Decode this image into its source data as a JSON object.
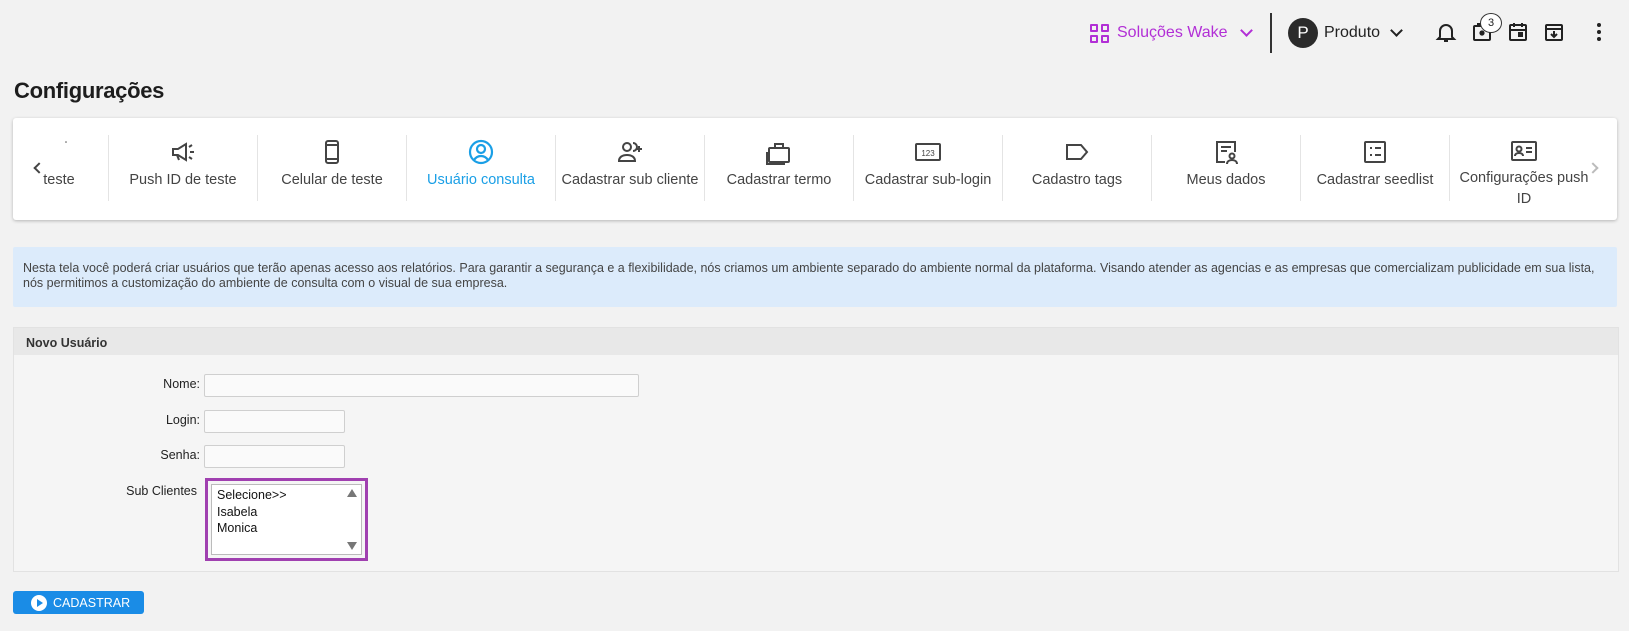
{
  "header": {
    "solucoes_label": "Soluções Wake",
    "avatar_letter": "P",
    "produto_label": "Produto",
    "badge_count": "3"
  },
  "page": {
    "title": "Configurações"
  },
  "tabs": [
    {
      "label": "teste",
      "icon": "partial-icon"
    },
    {
      "label": "Push ID de teste",
      "icon": "megaphone-icon"
    },
    {
      "label": "Celular de teste",
      "icon": "smartphone-icon"
    },
    {
      "label": "Usuário consulta",
      "icon": "account-circle-icon",
      "active": true
    },
    {
      "label": "Cadastrar sub cliente",
      "icon": "person-add-icon"
    },
    {
      "label": "Cadastrar termo",
      "icon": "briefcase-icon"
    },
    {
      "label": "Cadastrar sub-login",
      "icon": "pin-123-icon"
    },
    {
      "label": "Cadastro tags",
      "icon": "label-icon"
    },
    {
      "label": "Meus dados",
      "icon": "profile-document-icon"
    },
    {
      "label": "Cadastrar seedlist",
      "icon": "checklist-icon"
    },
    {
      "label": "Configurações push ID",
      "icon": "id-card-icon"
    }
  ],
  "info_text": "Nesta tela você poderá criar usuários que terão apenas acesso aos relatórios. Para garantir a segurança e a flexibilidade, nós criamos um ambiente separado do ambiente normal da plataforma. Visando atender as agencias e as empresas que comercializam publicidade em sua lista, nós permitimos a customização do ambiente de consulta com o visual de sua empresa.",
  "form": {
    "title": "Novo Usuário",
    "nome_label": "Nome:",
    "nome_value": "",
    "login_label": "Login:",
    "login_value": "",
    "senha_label": "Senha:",
    "senha_value": "",
    "subclientes_label": "Sub Clientes",
    "subclientes_options": [
      "Selecione>>",
      "Isabela",
      "Monica"
    ]
  },
  "actions": {
    "cadastrar_label": "CADASTRAR"
  },
  "colors": {
    "accent": "#1a9fe6",
    "brand_purple": "#b22fd6",
    "primary_button": "#1a8ce6",
    "info_bg": "#dcebfb"
  }
}
